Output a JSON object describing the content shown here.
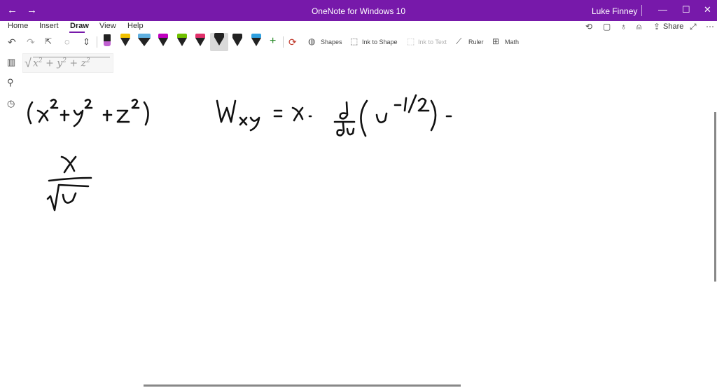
{
  "window": {
    "title": "OneNote for Windows 10",
    "user": "Luke Finney",
    "back_glyph": "←",
    "forward_glyph": "→",
    "minimize_glyph": "—",
    "maximize_glyph": "☐",
    "close_glyph": "✕"
  },
  "ribbon": {
    "tabs": [
      {
        "label": "Home"
      },
      {
        "label": "Insert"
      },
      {
        "label": "Draw"
      },
      {
        "label": "View"
      },
      {
        "label": "Help"
      }
    ],
    "active_tab": "Draw",
    "share_label": "Share"
  },
  "toolbar": {
    "shapes_label": "Shapes",
    "ink_to_shape_label": "Ink to Shape",
    "ink_to_text_label": "Ink to Text",
    "ruler_label": "Ruler",
    "math_label": "Math",
    "add_glyph": "+",
    "pens": [
      {
        "kind": "highlighter",
        "color": "#c060d0"
      },
      {
        "kind": "pen",
        "color": "#f0c000"
      },
      {
        "kind": "pen",
        "color": "#60b0e0"
      },
      {
        "kind": "pen",
        "color": "#c000c0"
      },
      {
        "kind": "pen",
        "color": "#70c000"
      },
      {
        "kind": "pen",
        "color": "#e0306a"
      },
      {
        "kind": "pen",
        "color": "#222222",
        "selected": true
      },
      {
        "kind": "pen",
        "color": "#222222"
      },
      {
        "kind": "pen",
        "color": "#30a0e0"
      }
    ]
  },
  "colors": {
    "titlebar": "#7719aa",
    "accent": "#7719aa",
    "ink": "#111111"
  },
  "note": {
    "math_preview": {
      "x": "x",
      "y": "y",
      "z": "z",
      "exp": "2",
      "plus": "+"
    }
  }
}
